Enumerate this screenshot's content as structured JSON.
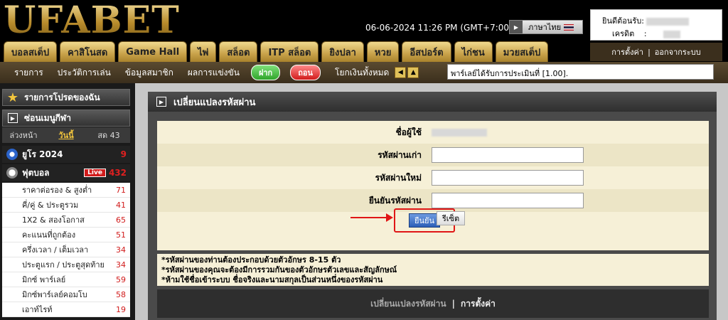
{
  "header": {
    "logo": "UFABET",
    "datetime": "06-06-2024 11:26 PM (GMT+7:00)",
    "language": "ภาษาไทย",
    "account": {
      "welcome_label": "ยินดีต้อนรับ:",
      "credit_label": "เครดิต",
      "credit_sep": ":"
    },
    "links": {
      "settings": "การตั้งค่า",
      "sep": "|",
      "logout": "ออกจากระบบ"
    },
    "tabs": [
      "บอลสเต็ป",
      "คาสิโนสด",
      "Game Hall",
      "ไพ่",
      "สล็อต",
      "ITP สล็อต",
      "ยิงปลา",
      "หวย",
      "อีสปอร์ต",
      "ไก่ชน",
      "มวยสเต็ป"
    ]
  },
  "subnav": {
    "items": [
      "รายการ",
      "ประวัติการเล่น",
      "ข้อมูลสมาชิก",
      "ผลการแข่งขัน"
    ],
    "deposit": "ฝาก",
    "withdraw": "ถอน",
    "transfer_all": "โยกเงินทั้งหมด",
    "ticker": "พาร์เลย์ได้รับการประเมินที่ [1.00]."
  },
  "sidebar": {
    "fav_title": "รายการโปรดของฉัน",
    "hide_menu": "ซ่อนเมนูกีฬา",
    "day_tabs": [
      "ล่วงหน้า",
      "วันนี้",
      "สด 43"
    ],
    "sports": [
      {
        "name": "ยูโร 2024",
        "count": "9"
      },
      {
        "name": "ฟุตบอล",
        "badge": "Live",
        "count": "432"
      }
    ],
    "football_items": [
      {
        "label": "ราคาต่อรอง & สูงต่ำ",
        "count": "71"
      },
      {
        "label": "คี่/คู่ & ประตูรวม",
        "count": "41"
      },
      {
        "label": "1X2 & สองโอกาส",
        "count": "65"
      },
      {
        "label": "คะแนนที่ถูกต้อง",
        "count": "51"
      },
      {
        "label": "ครึ่งเวลา / เต็มเวลา",
        "count": "34"
      },
      {
        "label": "ประตูแรก / ประตูสุดท้าย",
        "count": "34"
      },
      {
        "label": "มิกซ์ พาร์เลย์",
        "count": "59"
      },
      {
        "label": "มิกซ์พาร์เลย์คอมโบ",
        "count": "58"
      },
      {
        "label": "เอาท์ไรท์",
        "count": "19"
      }
    ]
  },
  "main": {
    "title": "เปลี่ยนแปลงรหัสผ่าน",
    "form": {
      "username_label": "ชื่อผู้ใช้",
      "old_password_label": "รหัสผ่านเก่า",
      "new_password_label": "รหัสผ่านใหม่",
      "confirm_password_label": "ยืนยันรหัสผ่าน",
      "submit": "ยืนยัน",
      "reset": "รีเซ็ต"
    },
    "notes": [
      "*รหัสผ่านของท่านต้องประกอบด้วยตัวอักษร 8-15 ตัว",
      "*รหัสผ่านของคุณจะต้องมีการรวมกันของตัวอักษรตัวเลขและสัญลักษณ์",
      "*ห้ามใช้ชื่อเข้าระบบ ชื่อจริงและนามสกุลเป็นส่วนหนึ่งของรหัสผ่าน"
    ],
    "footer": {
      "change_password": "เปลี่ยนแปลงรหัสผ่าน",
      "sep": "|",
      "settings": "การตั้งค่า"
    }
  }
}
